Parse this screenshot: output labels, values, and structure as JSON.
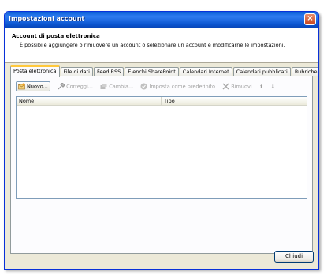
{
  "window": {
    "title": "Impostazioni account",
    "close_glyph": "×"
  },
  "header": {
    "title": "Account di posta elettronica",
    "description": "È possibile aggiungere o rimuovere un account o selezionare un account e modificarne le impostazioni."
  },
  "tabs": [
    {
      "label": "Posta elettronica",
      "active": true
    },
    {
      "label": "File di dati"
    },
    {
      "label": "Feed RSS"
    },
    {
      "label": "Elenchi SharePoint"
    },
    {
      "label": "Calendari Internet"
    },
    {
      "label": "Calendari pubblicati"
    },
    {
      "label": "Rubriche"
    }
  ],
  "toolbar": {
    "new_label": "Nuovo...",
    "repair_label": "Correggi...",
    "change_label": "Cambia...",
    "set_default_label": "Imposta come predefinito",
    "remove_label": "Rimuovi",
    "move_up_glyph": "⬆",
    "move_down_glyph": "⬇"
  },
  "list": {
    "columns": [
      "Nome",
      "Tipo"
    ]
  },
  "footer": {
    "close_label": "Chiudi"
  }
}
